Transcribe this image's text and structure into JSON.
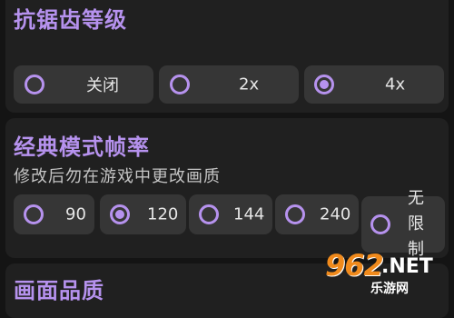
{
  "antialias": {
    "title": "抗锯齿等级",
    "options": [
      {
        "label": "关闭",
        "selected": false
      },
      {
        "label": "2x",
        "selected": false
      },
      {
        "label": "4x",
        "selected": true
      }
    ]
  },
  "classic_fps": {
    "title": "经典模式帧率",
    "subtitle": "修改后勿在游戏中更改画质",
    "options": [
      {
        "label": "90",
        "selected": false
      },
      {
        "label": "120",
        "selected": true
      },
      {
        "label": "144",
        "selected": false
      },
      {
        "label": "240",
        "selected": false
      },
      {
        "label": "无限制",
        "selected": false
      }
    ]
  },
  "quality": {
    "title": "画面品质"
  },
  "watermark": {
    "number": "962",
    "suffix": ".NET",
    "site": "乐游网"
  },
  "colors": {
    "accent": "#b692ee",
    "background": "#141414",
    "card": "#202020",
    "option": "#363636"
  }
}
